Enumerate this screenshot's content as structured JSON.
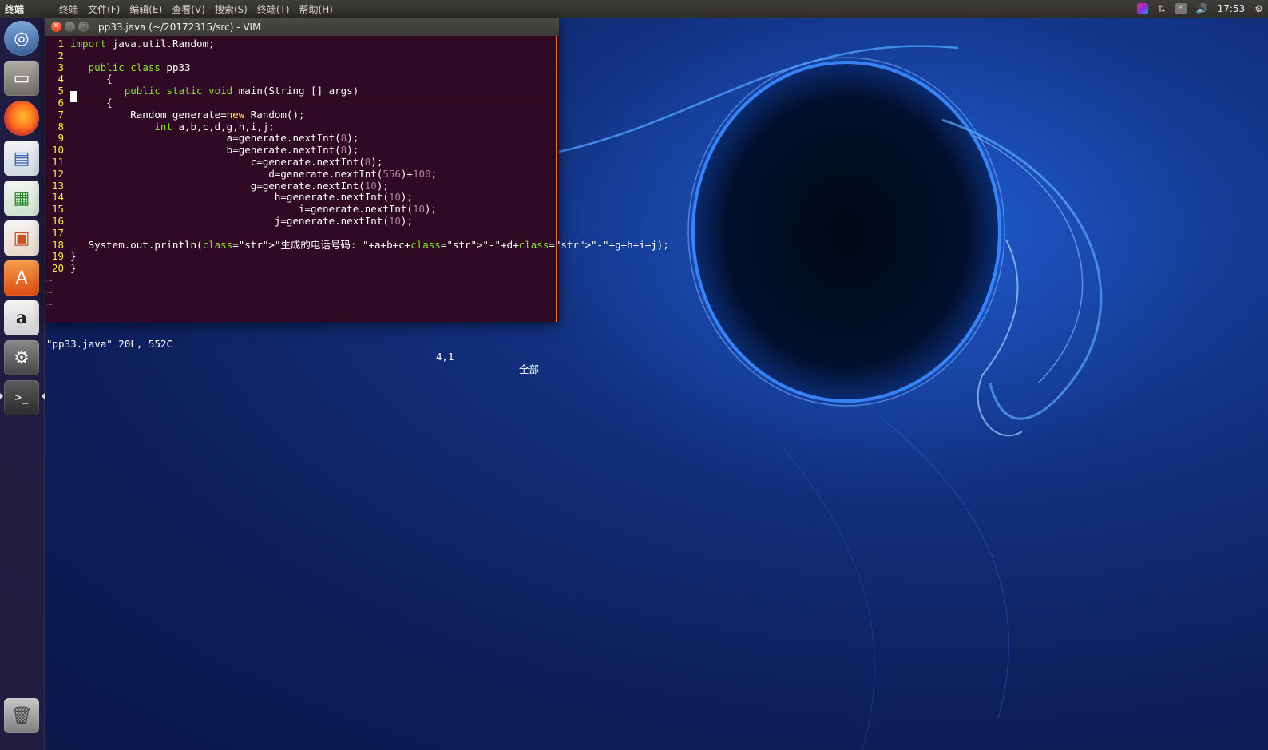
{
  "top_panel": {
    "app_name": "终端",
    "menu": [
      "终端",
      "文件(F)",
      "编辑(E)",
      "查看(V)",
      "搜索(S)",
      "终端(T)",
      "帮助(H)"
    ],
    "clock": "17:53",
    "kb_label": "Pi"
  },
  "launcher": {
    "icons": [
      "ubuntu-dash-icon",
      "files-icon",
      "firefox-icon",
      "libreoffice-writer-icon",
      "libreoffice-calc-icon",
      "libreoffice-impress-icon",
      "software-center-icon",
      "amazon-icon",
      "system-settings-icon",
      "terminal-icon",
      "trash-icon"
    ],
    "terminal_glyph": ">_",
    "amazon_glyph": "a",
    "store_glyph": "A"
  },
  "window": {
    "title": "pp33.java (~/20172315/src) - VIM"
  },
  "editor": {
    "lines": [
      {
        "n": "1",
        "code": "import java.util.Random;"
      },
      {
        "n": "2",
        "code": ""
      },
      {
        "n": "3",
        "code": "   public class pp33"
      },
      {
        "n": "4",
        "code": "      {"
      },
      {
        "n": "5",
        "code": "         public static void main(String [] args)"
      },
      {
        "n": "6",
        "code": "      {"
      },
      {
        "n": "7",
        "code": "          Random generate=new Random();"
      },
      {
        "n": "8",
        "code": "              int a,b,c,d,g,h,i,j;"
      },
      {
        "n": "9",
        "code": "                          a=generate.nextInt(8);"
      },
      {
        "n": "10",
        "code": "                          b=generate.nextInt(8);"
      },
      {
        "n": "11",
        "code": "                              c=generate.nextInt(8);"
      },
      {
        "n": "12",
        "code": "                                 d=generate.nextInt(556)+100;"
      },
      {
        "n": "13",
        "code": "                              g=generate.nextInt(10);"
      },
      {
        "n": "14",
        "code": "                                  h=generate.nextInt(10);"
      },
      {
        "n": "15",
        "code": "                                      i=generate.nextInt(10);"
      },
      {
        "n": "16",
        "code": "                                  j=generate.nextInt(10);"
      },
      {
        "n": "17",
        "code": ""
      },
      {
        "n": "18",
        "code": "   System.out.println(\"生成的电话号码: \"+a+b+c+\"-\"+d+\"-\"+g+h+i+j);"
      },
      {
        "n": "19",
        "code": "}"
      },
      {
        "n": "20",
        "code": "}"
      }
    ],
    "tildes": [
      "~",
      "~",
      "~"
    ],
    "status_file": "\"pp33.java\" 20L, 552C",
    "status_pos": "4,1",
    "status_all": "全部"
  }
}
